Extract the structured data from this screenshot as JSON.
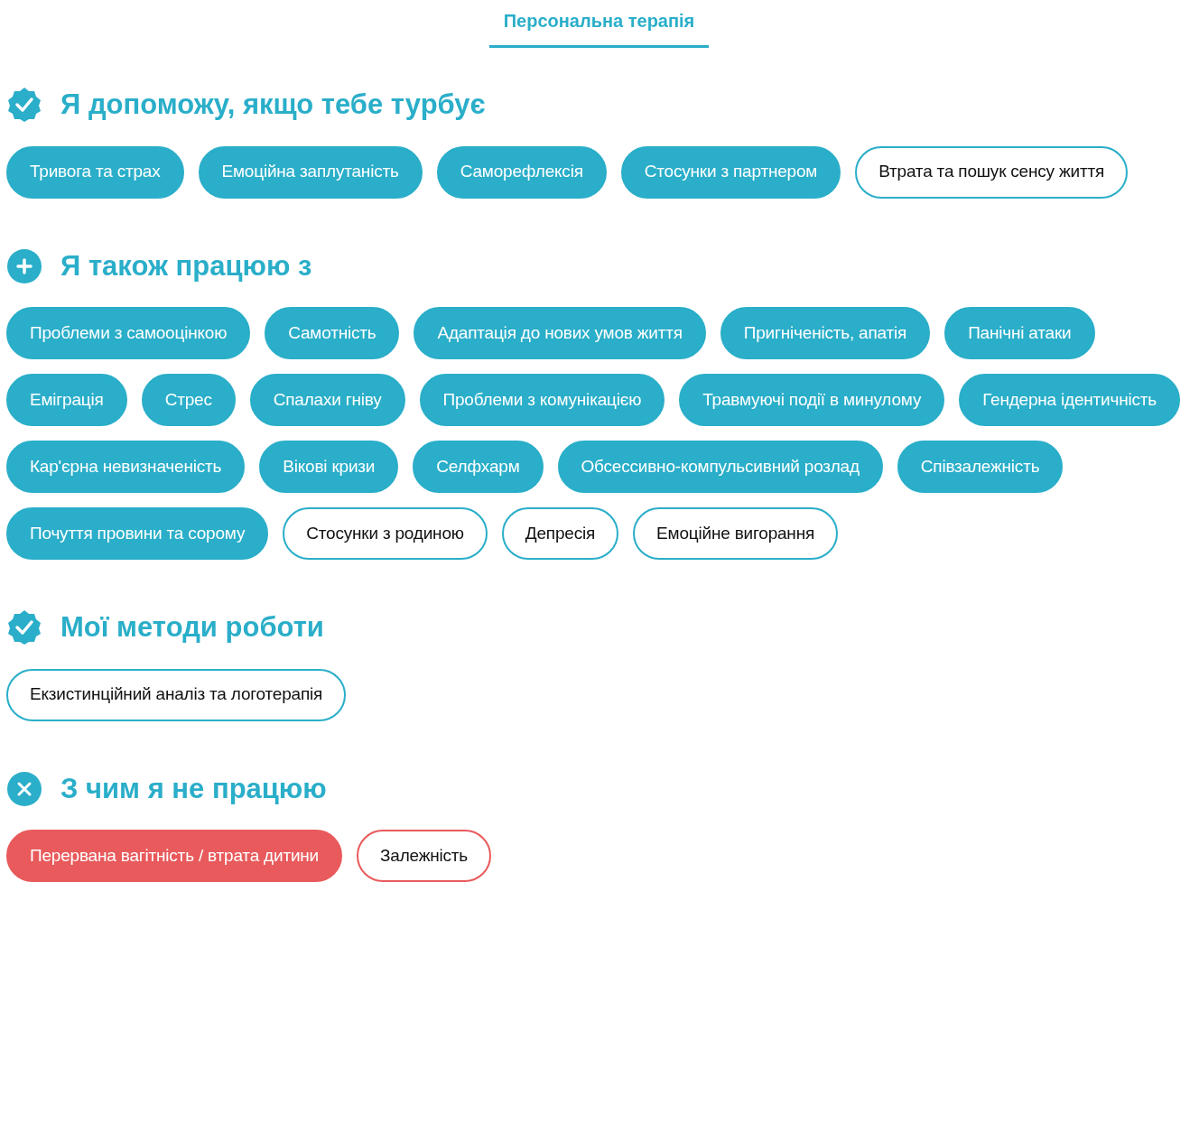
{
  "tab": {
    "label": "Персональна терапія",
    "selected": true
  },
  "sections": [
    {
      "kind": "check",
      "title": "Я допоможу, якщо тебе турбує",
      "chips": [
        {
          "label": "Тривога та страх",
          "selected": true
        },
        {
          "label": "Емоційна заплутаність",
          "selected": true
        },
        {
          "label": "Саморефлексія",
          "selected": true
        },
        {
          "label": "Стосунки з партнером",
          "selected": true
        },
        {
          "label": "Втрата та пошук сенсу життя",
          "selected": false
        }
      ]
    },
    {
      "kind": "plus",
      "title": "Я також працюю з",
      "chips": [
        {
          "label": "Проблеми з самооцінкою",
          "selected": true
        },
        {
          "label": "Самотність",
          "selected": true
        },
        {
          "label": "Адаптація до нових умов життя",
          "selected": true
        },
        {
          "label": "Пригніченість, апатія",
          "selected": true
        },
        {
          "label": "Панічні атаки",
          "selected": true
        },
        {
          "label": "Еміграція",
          "selected": true
        },
        {
          "label": "Стрес",
          "selected": true
        },
        {
          "label": "Спалахи гніву",
          "selected": true
        },
        {
          "label": "Проблеми з комунікацією",
          "selected": true
        },
        {
          "label": "Травмуючі події в минулому",
          "selected": true
        },
        {
          "label": "Гендерна ідентичність",
          "selected": true
        },
        {
          "label": "Кар'єрна невизначеність",
          "selected": true
        },
        {
          "label": "Вікові кризи",
          "selected": true
        },
        {
          "label": "Селфхарм",
          "selected": true
        },
        {
          "label": "Обсессивно-компульсивний розлад",
          "selected": true
        },
        {
          "label": "Співзалежність",
          "selected": true
        },
        {
          "label": "Почуття провини та сорому",
          "selected": true
        },
        {
          "label": "Стосунки з родиною",
          "selected": false
        },
        {
          "label": "Депресія",
          "selected": false
        },
        {
          "label": "Емоційне вигорання",
          "selected": false
        }
      ]
    },
    {
      "kind": "check",
      "title": "Мої методи роботи",
      "chips": [
        {
          "label": "Екзистинційний аналіз та логотерапія",
          "selected": false
        }
      ]
    },
    {
      "kind": "cross",
      "title": "З чим я не працюю",
      "chips": [
        {
          "label": "Перервана вагітність / втрата дитини",
          "selected": true
        },
        {
          "label": "Залежність",
          "selected": false
        }
      ]
    }
  ]
}
